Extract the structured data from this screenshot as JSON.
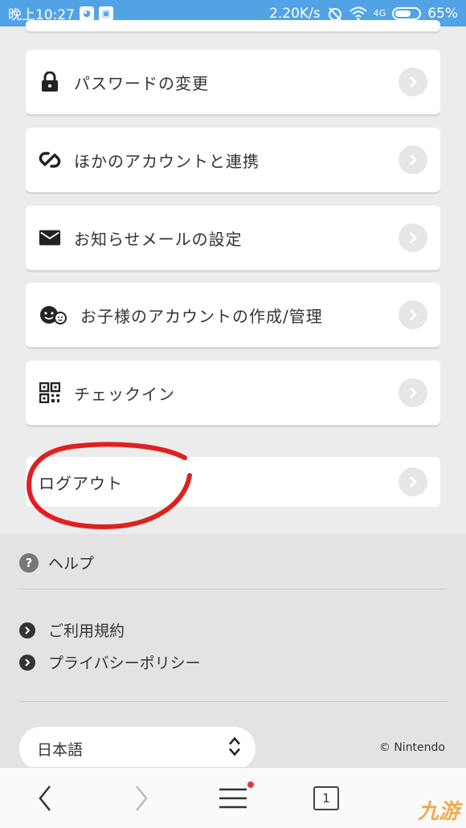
{
  "status_bar": {
    "time": "晚上10:27",
    "speed": "2.20K/s",
    "network": "4G",
    "battery": "65%"
  },
  "menu": {
    "items": [
      {
        "label": "パスワードの変更",
        "icon": "lock-icon"
      },
      {
        "label": "ほかのアカウントと連携",
        "icon": "link-icon"
      },
      {
        "label": "お知らせメールの設定",
        "icon": "mail-icon"
      },
      {
        "label": "お子様のアカウントの作成/管理",
        "icon": "family-icon"
      },
      {
        "label": "チェックイン",
        "icon": "qr-code-icon"
      }
    ],
    "logout_label": "ログアウト"
  },
  "footer": {
    "help_label": "ヘルプ",
    "links": [
      "ご利用規約",
      "プライバシーポリシー"
    ],
    "language": "日本語",
    "copyright": "© Nintendo"
  },
  "navbar": {
    "tab_count": "1"
  },
  "colors": {
    "status_bar": "#52a3e6",
    "annotation": "#e02020"
  }
}
